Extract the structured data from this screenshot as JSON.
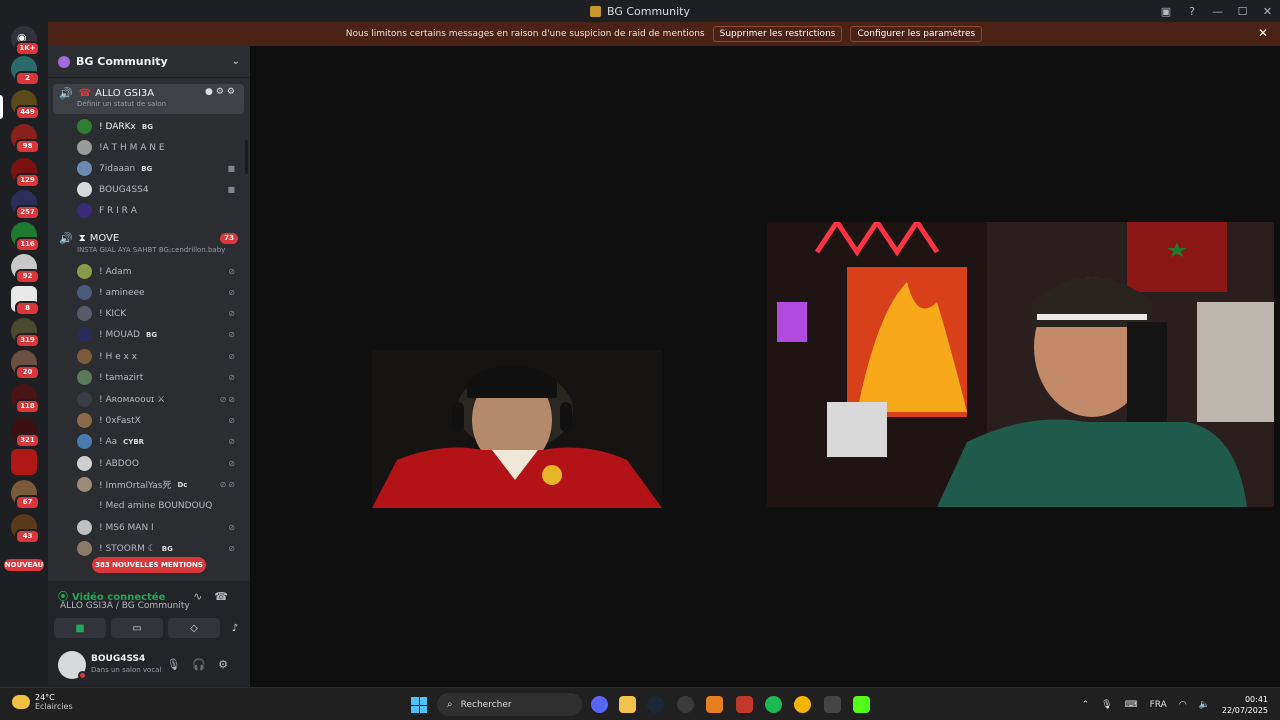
{
  "window": {
    "title": "BG Community"
  },
  "notice": {
    "text": "Nous limitons certains messages en raison d'une suspicion de raid de mentions",
    "btn_remove": "Supprimer les restrictions",
    "btn_configure": "Configurer les paramètres"
  },
  "rail": {
    "badges": [
      "1K+",
      "2",
      "449",
      "98",
      "129",
      "257",
      "116",
      "92",
      "8",
      "319",
      "20",
      "118",
      "321",
      "",
      "67",
      "43"
    ],
    "new_label": "NOUVEAU"
  },
  "guild": {
    "name": "BG Community"
  },
  "channels": [
    {
      "name": "ALLO GSI3A",
      "topic": "Définir un statut de salon",
      "members": [
        {
          "name": "! DARKx",
          "tag": "BG"
        },
        {
          "name": "!A T H M A N E",
          "tag": ""
        },
        {
          "name": "7idaaan",
          "tag": "BG"
        },
        {
          "name": "BOUG4SS4",
          "tag": ""
        },
        {
          "name": "F R I R A",
          "tag": ""
        }
      ]
    },
    {
      "name": "MOVE",
      "topic": "INSTA GIAL AYA SAHBT BG;cendrillon.baby",
      "count": "73",
      "members": [
        {
          "name": "! Adam",
          "tag": ""
        },
        {
          "name": "! amineee",
          "tag": ""
        },
        {
          "name": "! KICK",
          "tag": ""
        },
        {
          "name": "! MOUAD",
          "tag": "BG"
        },
        {
          "name": "! H e x x",
          "tag": ""
        },
        {
          "name": "! tamazirt",
          "tag": ""
        },
        {
          "name": "! Aʀᴏᴍᴀᴏᴏᴜɪ ⚔",
          "tag": ""
        },
        {
          "name": "! 0xFastX",
          "tag": ""
        },
        {
          "name": "! Aa",
          "tag": "CYBR"
        },
        {
          "name": "! ABDOO",
          "tag": ""
        },
        {
          "name": "! ImmOrtalYas死",
          "tag": "Dc"
        },
        {
          "name": "! Med amine BOUNDOUQ",
          "tag": ""
        },
        {
          "name": "! MS6 MAN I",
          "tag": ""
        },
        {
          "name": "! STOORM ☾",
          "tag": "BG"
        }
      ]
    }
  ],
  "mentions_pill": "383 NOUVELLES MENTIONS",
  "voice": {
    "status": "Vidéo connectée",
    "channel": "ALLO GSI3A / BG Community"
  },
  "user": {
    "name": "BOUG4SS4",
    "status": "Dans un salon vocal"
  },
  "taskbar": {
    "temp": "24°C",
    "weather": "Eclaircies",
    "search": "Rechercher",
    "lang": "FRA",
    "time": "00:41",
    "date": "22/07/2025"
  },
  "colors": {
    "accent_red": "#da373c",
    "connected_green": "#23a55a",
    "notice_bg": "#4a2216"
  }
}
